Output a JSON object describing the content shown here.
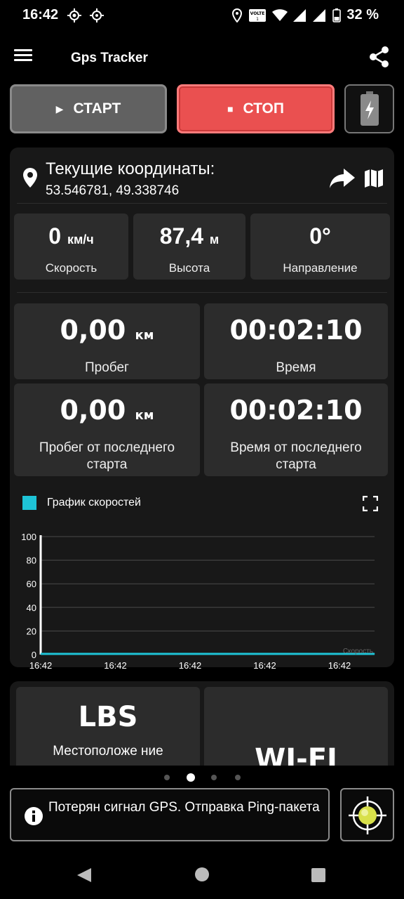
{
  "status_bar": {
    "time": "16:42",
    "battery_percent": "32 %",
    "icons": [
      "gps-icon",
      "gps-icon",
      "location-icon",
      "volte-icon",
      "wifi-icon",
      "signal-icon",
      "signal-icon",
      "battery-icon"
    ]
  },
  "app_bar": {
    "title": "Gps Tracker",
    "icons": [
      "menu-icon",
      "share-icon"
    ]
  },
  "controls": {
    "start_label": "СТАРТ",
    "stop_label": "СТОП",
    "battery_icon": "battery-charging-icon"
  },
  "coordinates": {
    "title": "Текущие координаты:",
    "value": "53.546781, 49.338746",
    "icons": [
      "location-pin-icon",
      "share-arrow-icon",
      "map-icon"
    ]
  },
  "stats_small": [
    {
      "value": "0",
      "unit": "км/ч",
      "label": "Скорость"
    },
    {
      "value": "87,4",
      "unit": "м",
      "label": "Высота"
    },
    {
      "value": "0°",
      "unit": "",
      "label": "Направление"
    }
  ],
  "stats_large": [
    {
      "value": "0,00",
      "unit": "км",
      "label": "Пробег"
    },
    {
      "value": "00:02:10",
      "unit": "",
      "label": "Время"
    },
    {
      "value": "0,00",
      "unit": "км",
      "label": "Пробег от последнего старта"
    },
    {
      "value": "00:02:10",
      "unit": "",
      "label": "Время от последнего старта"
    }
  ],
  "chart": {
    "title": "График скоростей",
    "legend_color": "#1ec3d6"
  },
  "chart_data": {
    "type": "line",
    "title": "График скоростей",
    "xlabel": "",
    "ylabel": "",
    "ylim": [
      0,
      100
    ],
    "yticks": [
      "100",
      "80",
      "60",
      "40",
      "20",
      "0"
    ],
    "x": [
      "16:42",
      "16:42",
      "16:42",
      "16:42",
      "16:42"
    ],
    "series": [
      {
        "name": "Скорость",
        "color": "#1ec3d6",
        "values": [
          0,
          0,
          0,
          0,
          0
        ]
      }
    ],
    "grid": true
  },
  "bottom_tiles": [
    {
      "title": "LBS",
      "label": "Местоположе ние"
    },
    {
      "title": "WI-FI"
    }
  ],
  "pager": {
    "count": 4,
    "active": 1
  },
  "message": {
    "text": "Потерян сигнал GPS. Отправка Ping-пакета",
    "icon": "info-icon"
  },
  "target_button": {
    "icon": "crosshair-target-icon"
  },
  "nav": {
    "icons": [
      "back-icon",
      "home-icon",
      "recents-icon"
    ]
  }
}
